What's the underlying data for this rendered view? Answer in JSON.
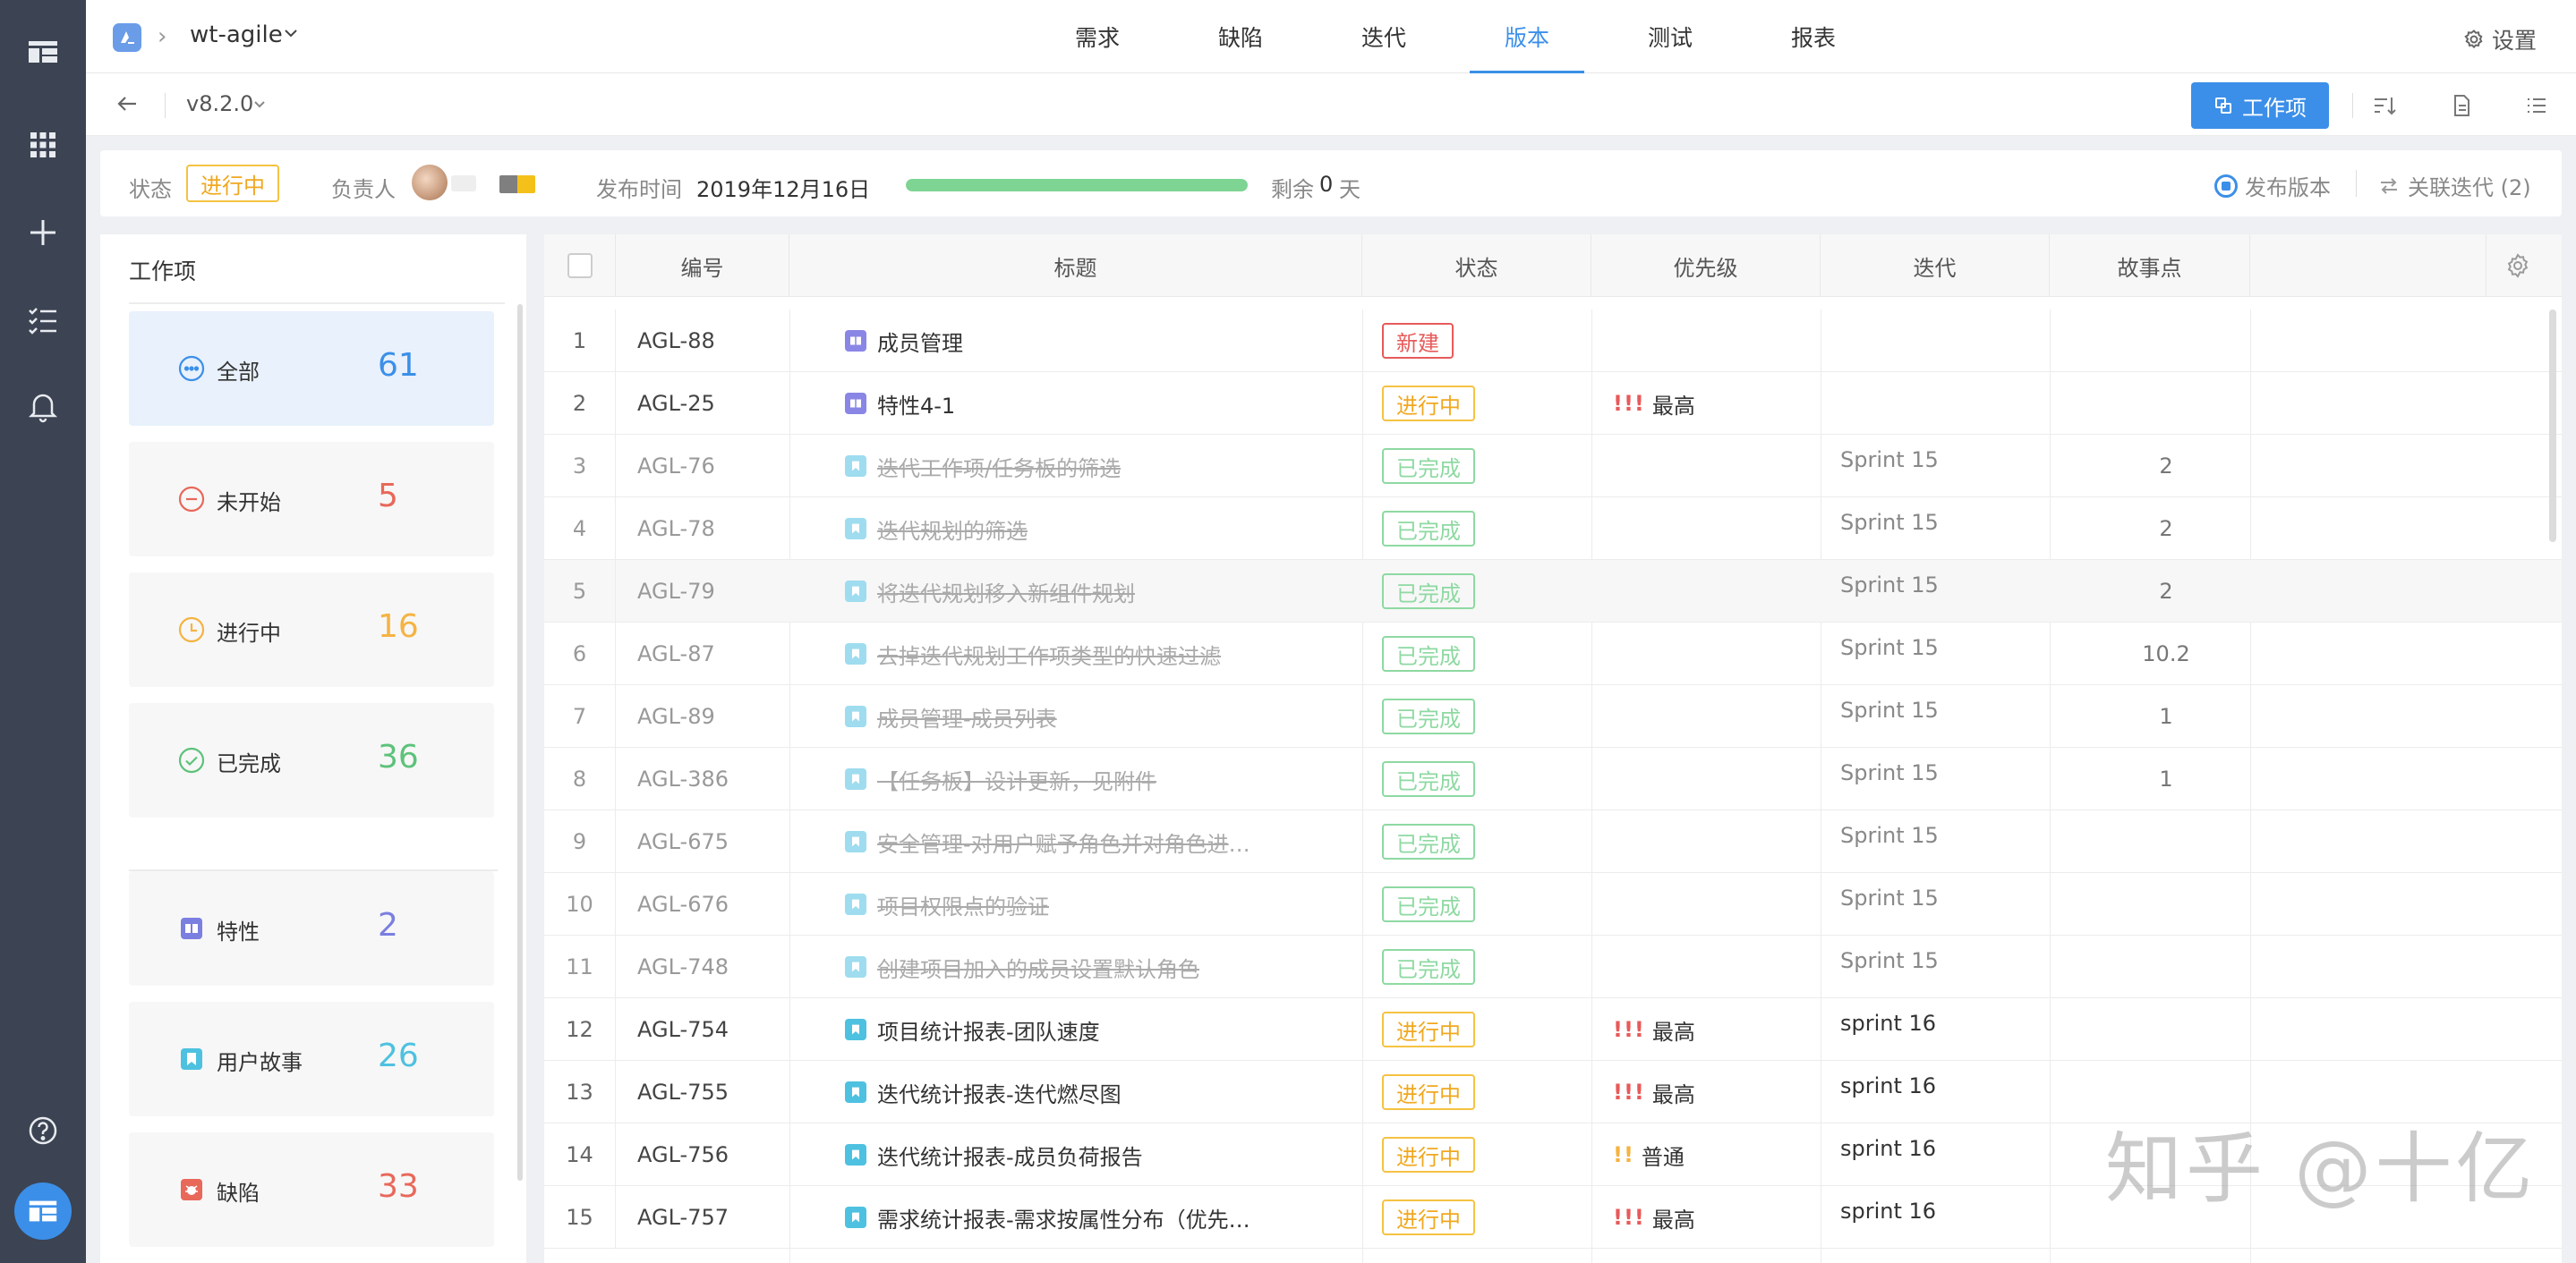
{
  "header": {
    "project": "wt-agile",
    "tabs": [
      {
        "label": "需求"
      },
      {
        "label": "缺陷"
      },
      {
        "label": "迭代"
      },
      {
        "label": "版本",
        "active": true
      },
      {
        "label": "测试"
      },
      {
        "label": "报表"
      }
    ],
    "settings": "设置"
  },
  "version_bar": {
    "version": "v8.2.0",
    "workitem_button": "工作项"
  },
  "status_bar": {
    "state_label": "状态",
    "state_value": "进行中",
    "owner_label": "负责人",
    "release_label": "发布时间",
    "release_date": "2019年12月16日",
    "progress_fraction": 1.0,
    "remain_label": "剩余",
    "remain_days": "0",
    "remain_unit": "天",
    "publish": "发布版本",
    "linked_iterations": "关联迭代 (2)"
  },
  "sidebar": {
    "title": "工作项",
    "categories": [
      {
        "label": "全部",
        "count": "61",
        "color": "#3b8fe8",
        "icon": "ellipsis-circle-icon"
      },
      {
        "label": "未开始",
        "count": "5",
        "color": "#e8685a",
        "icon": "minus-circle-icon"
      },
      {
        "label": "进行中",
        "count": "16",
        "color": "#f5b342",
        "icon": "clock-icon"
      },
      {
        "label": "已完成",
        "count": "36",
        "color": "#5dc27a",
        "icon": "check-circle-icon"
      },
      {
        "label": "特性",
        "count": "2",
        "color": "#7b7fe0",
        "icon": "feature-icon"
      },
      {
        "label": "用户故事",
        "count": "26",
        "color": "#4ec1e0",
        "icon": "story-icon"
      },
      {
        "label": "缺陷",
        "count": "33",
        "color": "#e8685a",
        "icon": "bug-icon"
      }
    ]
  },
  "table": {
    "columns": [
      "编号",
      "标题",
      "状态",
      "优先级",
      "迭代",
      "故事点"
    ],
    "rows": [
      {
        "idx": "1",
        "code": "AGL-88",
        "title": "成员管理",
        "type": "feature",
        "state": "新建",
        "prio": "",
        "prio_mark": "",
        "iter": "",
        "points": ""
      },
      {
        "idx": "2",
        "code": "AGL-25",
        "title": "特性4-1",
        "type": "feature",
        "state": "进行中",
        "prio": "最高",
        "prio_mark": "!!!",
        "iter": "",
        "points": ""
      },
      {
        "idx": "3",
        "code": "AGL-76",
        "title": "迭代工作项/任务板的筛选",
        "type": "story",
        "state": "已完成",
        "prio": "",
        "prio_mark": "",
        "iter": "Sprint 15",
        "points": "2"
      },
      {
        "idx": "4",
        "code": "AGL-78",
        "title": "迭代规划的筛选",
        "type": "story",
        "state": "已完成",
        "prio": "",
        "prio_mark": "",
        "iter": "Sprint 15",
        "points": "2"
      },
      {
        "idx": "5",
        "code": "AGL-79",
        "title": "将迭代规划移入新组件规划",
        "type": "story",
        "state": "已完成",
        "prio": "",
        "prio_mark": "",
        "iter": "Sprint 15",
        "points": "2"
      },
      {
        "idx": "6",
        "code": "AGL-87",
        "title": "去掉迭代规划工作项类型的快速过滤",
        "type": "story",
        "state": "已完成",
        "prio": "",
        "prio_mark": "",
        "iter": "Sprint 15",
        "points": "10.2"
      },
      {
        "idx": "7",
        "code": "AGL-89",
        "title": "成员管理-成员列表",
        "type": "story",
        "state": "已完成",
        "prio": "",
        "prio_mark": "",
        "iter": "Sprint 15",
        "points": "1"
      },
      {
        "idx": "8",
        "code": "AGL-386",
        "title": "【任务板】设计更新，见附件",
        "type": "story",
        "state": "已完成",
        "prio": "",
        "prio_mark": "",
        "iter": "Sprint 15",
        "points": "1"
      },
      {
        "idx": "9",
        "code": "AGL-675",
        "title": "安全管理-对用户赋予角色并对角色进行权限配置",
        "type": "story",
        "state": "已完成",
        "prio": "",
        "prio_mark": "",
        "iter": "Sprint 15",
        "points": ""
      },
      {
        "idx": "10",
        "code": "AGL-676",
        "title": "项目权限点的验证",
        "type": "story",
        "state": "已完成",
        "prio": "",
        "prio_mark": "",
        "iter": "Sprint 15",
        "points": ""
      },
      {
        "idx": "11",
        "code": "AGL-748",
        "title": "创建项目加入的成员设置默认角色",
        "type": "story",
        "state": "已完成",
        "prio": "",
        "prio_mark": "",
        "iter": "Sprint 15",
        "points": ""
      },
      {
        "idx": "12",
        "code": "AGL-754",
        "title": "项目统计报表-团队速度",
        "type": "story",
        "state": "进行中",
        "prio": "最高",
        "prio_mark": "!!!",
        "iter": "sprint 16",
        "points": ""
      },
      {
        "idx": "13",
        "code": "AGL-755",
        "title": "迭代统计报表-迭代燃尽图",
        "type": "story",
        "state": "进行中",
        "prio": "最高",
        "prio_mark": "!!!",
        "iter": "sprint 16",
        "points": ""
      },
      {
        "idx": "14",
        "code": "AGL-756",
        "title": "迭代统计报表-成员负荷报告",
        "type": "story",
        "state": "进行中",
        "prio": "普通",
        "prio_mark": "!!",
        "iter": "sprint 16",
        "points": ""
      },
      {
        "idx": "15",
        "code": "AGL-757",
        "title": "需求统计报表-需求按属性分布（优先级、迭代…",
        "type": "story",
        "state": "进行中",
        "prio": "最高",
        "prio_mark": "!!!",
        "iter": "sprint 16",
        "points": ""
      }
    ]
  },
  "watermark": "知乎 @十亿",
  "colors": {
    "accent": "#3b8fe8",
    "new": "#e85a5a",
    "in_progress": "#f5b342",
    "done": "#7ed493",
    "nav_bg": "#3c4352"
  }
}
